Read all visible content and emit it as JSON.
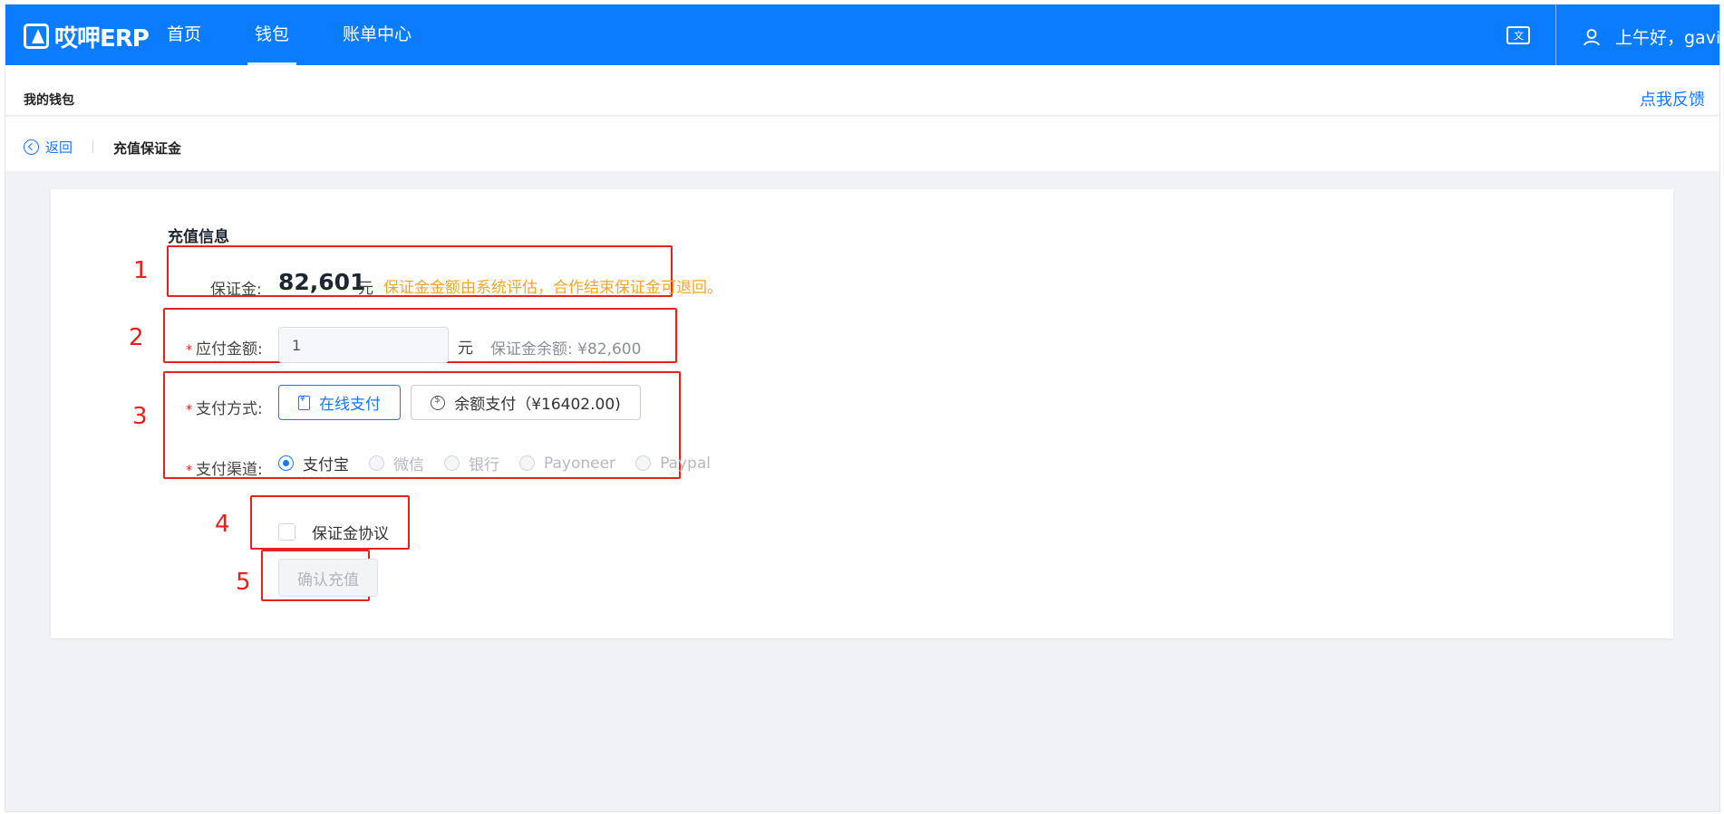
{
  "brand": {
    "name": "哎呷ERP"
  },
  "nav": {
    "items": [
      {
        "label": "首页"
      },
      {
        "label": "钱包"
      },
      {
        "label": "账单中心"
      }
    ],
    "active": "钱包"
  },
  "header": {
    "language_icon": "translate-icon",
    "user_icon": "user-icon",
    "greeting": "上午好，gavin"
  },
  "subheader": {
    "title": "我的钱包",
    "feedback": "点我反馈"
  },
  "breadcrumb": {
    "back": "返回",
    "current": "充值保证金"
  },
  "form": {
    "section_title": "充值信息",
    "deposit_label": "保证金:",
    "deposit_value": "82,601",
    "unit": "元",
    "deposit_hint": "保证金金额由系统评估，合作结束保证金可退回。",
    "amount_label": "应付金额:",
    "amount_value": "1",
    "balance_text": "保证金余额:  ¥82,600",
    "pay_method_label": "支付方式:",
    "pay_online": "在线支付",
    "pay_balance": "余额支付（¥16402.00)",
    "channel_label": "支付渠道:",
    "channels": [
      "支付宝",
      "微信",
      "银行",
      "Payoneer",
      "Paypal"
    ],
    "selected_channel": "支付宝",
    "agreement": "保证金协议",
    "confirm": "确认充值",
    "required_mark": "*"
  },
  "annotations": [
    "1",
    "2",
    "3",
    "4",
    "5"
  ],
  "colors": {
    "primary": "#0a7cff",
    "annotation": "#e8211c",
    "hint": "#f5a623"
  }
}
